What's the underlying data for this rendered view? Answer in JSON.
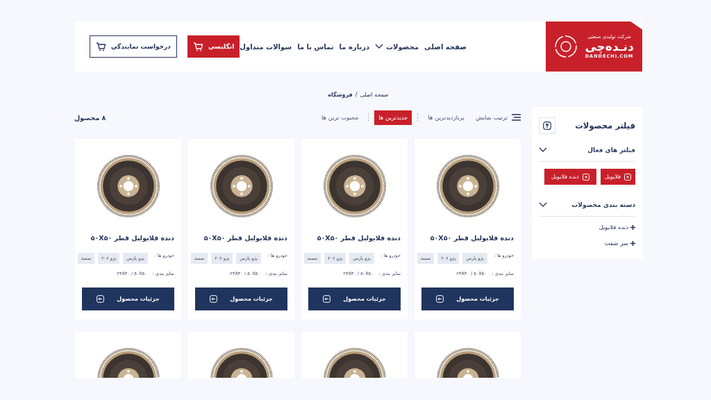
{
  "header": {
    "logo": {
      "tagline": "شرکت تولیدی صنعتی",
      "name": "دنـده‌چی",
      "domain": "DANDECHI.COM"
    },
    "nav": [
      {
        "label": "صفحه اصلی",
        "has_dropdown": false
      },
      {
        "label": "محصولات",
        "has_dropdown": true
      },
      {
        "label": "درباره ما",
        "has_dropdown": false
      },
      {
        "label": "تماس با ما",
        "has_dropdown": false
      },
      {
        "label": "سوالات متداول",
        "has_dropdown": false
      }
    ],
    "buttons": [
      {
        "label": "انگلیسی",
        "kind": "primary"
      },
      {
        "label": "درخواست نمایندگی",
        "kind": "outline"
      }
    ]
  },
  "breadcrumb": {
    "items": [
      "صفحه اصلی",
      "فروشگاه"
    ],
    "separator": "/"
  },
  "sidebar": {
    "title": "فیلتر محصولات",
    "sections": [
      {
        "title": "فیلتر های فعال",
        "kind": "chips",
        "expanded": true,
        "items": [
          "فلایویل",
          "دنده فلایویل"
        ]
      },
      {
        "title": "دسته بندی محصولات",
        "kind": "links",
        "expanded": true,
        "items": [
          "دنده فلایویل",
          "سر شفت"
        ]
      }
    ]
  },
  "toolbar": {
    "sort_label": "ترتیب نمایش",
    "options": [
      {
        "label": "پربازدیدترین ها",
        "selected": false
      },
      {
        "label": "جدیدترین ها",
        "selected": true
      },
      {
        "label": "محبوب ترین ها",
        "selected": false
      }
    ],
    "count": "۸ محصول"
  },
  "products": [
    {
      "kind": "full",
      "name": "دنده فلایولیل قطر ۵۰X۵۰",
      "cars_label": "خودرو ها :",
      "cars": [
        "پژو پارس",
        "پژو ۲۰۶",
        "سمند"
      ],
      "size_label": "سایز بندی :",
      "size": "۲۳X۳۰ / ۵۰X۵۰",
      "button": "جزئیات محصول"
    },
    {
      "kind": "full",
      "name": "دنده فلایولیل قطر ۵۰X۵۰",
      "cars_label": "خودرو ها :",
      "cars": [
        "پژو پارس",
        "پژو ۲۰۶",
        "سمند"
      ],
      "size_label": "سایز بندی :",
      "size": "۲۳X۳۰ / ۵۰X۵۰",
      "button": "جزئیات محصول"
    },
    {
      "kind": "full",
      "name": "دنده فلایولیل قطر ۵۰X۵۰",
      "cars_label": "خودرو ها :",
      "cars": [
        "پژو پارس",
        "پژو ۲۰۶",
        "سمند"
      ],
      "size_label": "سایز بندی :",
      "size": "۲۳X۳۰ / ۵۰X۵۰",
      "button": "جزئیات محصول"
    },
    {
      "kind": "full",
      "name": "دنده فلایولیل قطر ۵۰X۵۰",
      "cars_label": "خودرو ها :",
      "cars": [
        "پژو پارس",
        "پژو ۲۰۶",
        "سمند"
      ],
      "size_label": "سایز بندی :",
      "size": "۲۳X۳۰ / ۵۰X۵۰",
      "button": "جزئیات محصول"
    },
    {
      "kind": "cut"
    },
    {
      "kind": "cut"
    },
    {
      "kind": "cut"
    },
    {
      "kind": "cut"
    }
  ]
}
